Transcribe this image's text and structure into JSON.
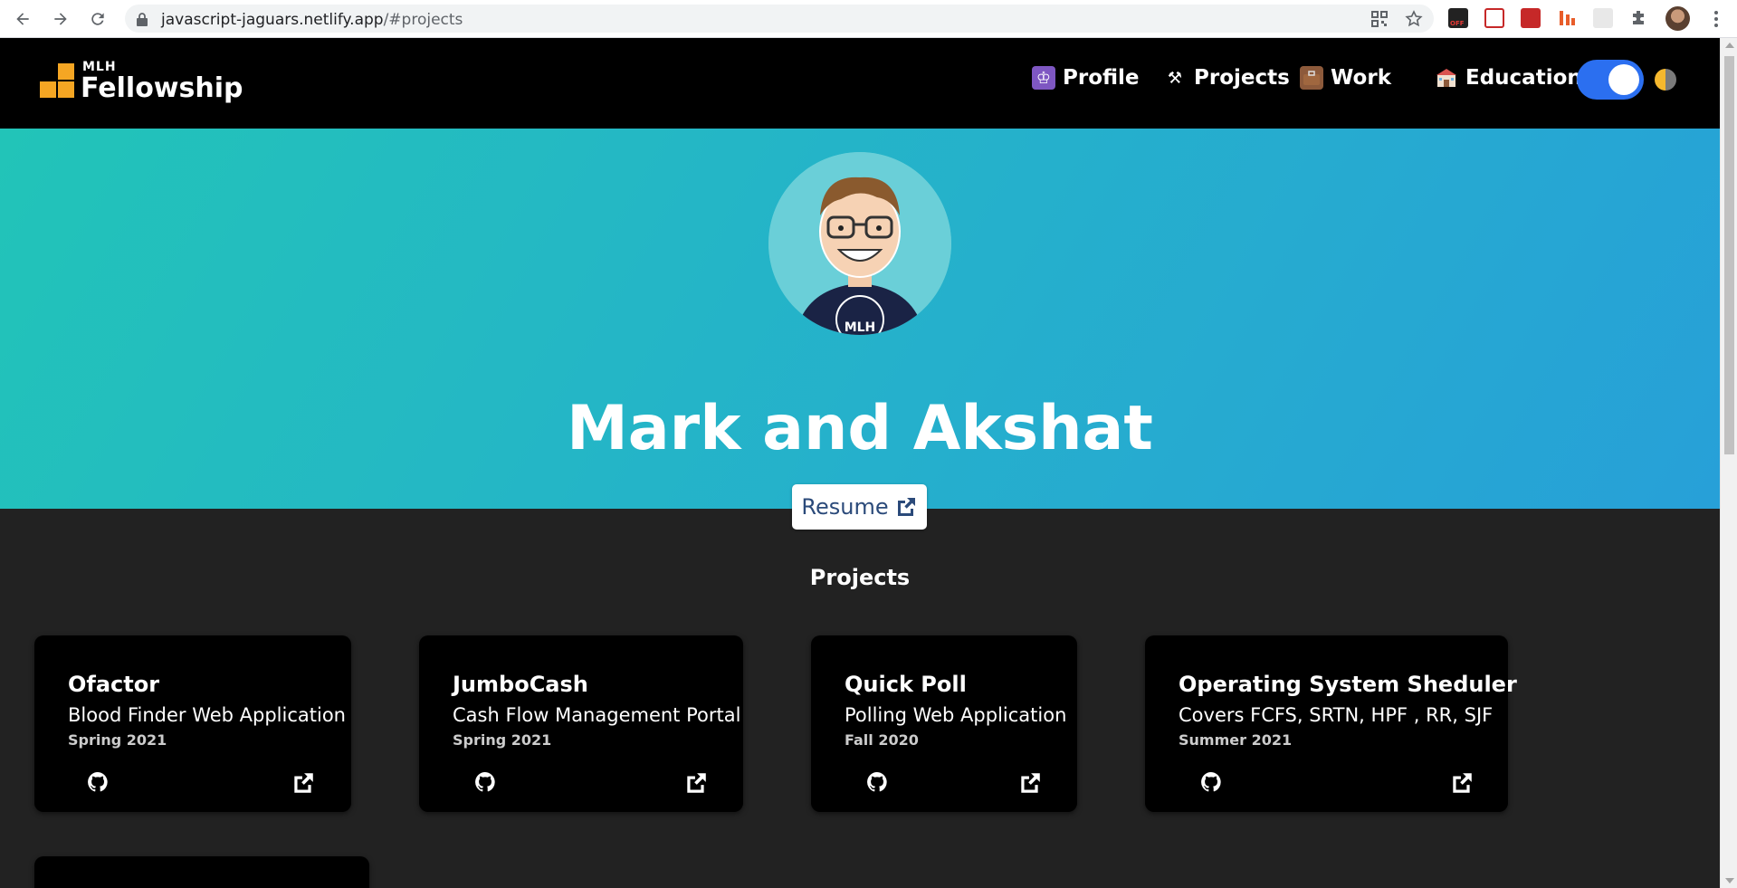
{
  "browser": {
    "url_host": "javascript-jaguars.netlify.app",
    "url_path": "/#projects"
  },
  "header": {
    "logo_mlh": "MLH",
    "logo_text": "Fellowship",
    "nav": [
      {
        "label": "Profile",
        "icon": "purple-badge-icon"
      },
      {
        "label": "Projects",
        "icon": "hammer-wrench-icon"
      },
      {
        "label": "Work",
        "icon": "briefcase-icon"
      },
      {
        "label": "Education",
        "icon": "school-icon"
      }
    ],
    "theme_toggle_on": true
  },
  "hero": {
    "title": "Mark and Akshat",
    "resume_label": "Resume",
    "gradient": [
      "#22c4b8",
      "#27a0d8"
    ]
  },
  "projects": {
    "section_title": "Projects",
    "items": [
      {
        "title": "Ofactor",
        "description": "Blood Finder Web Application",
        "term": "Spring 2021"
      },
      {
        "title": "JumboCash",
        "description": "Cash Flow Management Portal",
        "term": "Spring 2021"
      },
      {
        "title": "Quick Poll",
        "description": "Polling Web Application",
        "term": "Fall 2020"
      },
      {
        "title": "Operating System Sheduler",
        "description": "Covers FCFS, SRTN, HPF , RR, SJF",
        "term": "Summer 2021"
      }
    ]
  },
  "colors": {
    "accent_blue": "#2b6ff0",
    "logo_orange": "#f5a623",
    "page_bg": "#222222",
    "card_bg": "#000000"
  }
}
